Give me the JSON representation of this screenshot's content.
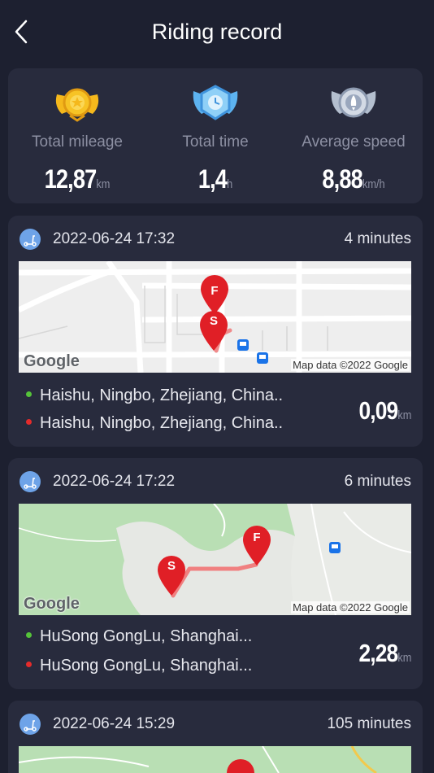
{
  "header": {
    "title": "Riding record",
    "back_icon": "chevron-left-icon"
  },
  "stats": [
    {
      "label": "Total mileage",
      "value": "12,87",
      "unit": "km",
      "badge": "gold-medal-icon"
    },
    {
      "label": "Total time",
      "value": "1,4",
      "unit": "h",
      "badge": "blue-clock-medal-icon"
    },
    {
      "label": "Average speed",
      "value": "8,88",
      "unit": "km/h",
      "badge": "silver-rocket-medal-icon"
    }
  ],
  "rides": [
    {
      "date": "2022-06-24 17:32",
      "duration": "4 minutes",
      "start": "Haishu, Ningbo, Zhejiang, China..",
      "end": "Haishu, Ningbo, Zhejiang, China..",
      "distance": "0,09",
      "unit": "km",
      "map_attribution": "Map data ©2022 Google",
      "map_logo": "Google"
    },
    {
      "date": "2022-06-24 17:22",
      "duration": "6 minutes",
      "start": "HuSong GongLu, Shanghai...",
      "end": "HuSong GongLu, Shanghai...",
      "distance": "2,28",
      "unit": "km",
      "map_attribution": "Map data ©2022 Google",
      "map_logo": "Google"
    },
    {
      "date": "2022-06-24 15:29",
      "duration": "105 minutes"
    }
  ],
  "colors": {
    "background": "#1d2030",
    "card": "#282b3d",
    "accent_blue": "#6ea3e8",
    "start_dot": "#55c33a",
    "end_dot": "#e52b2b",
    "marker": "#e01f26",
    "route": "#f08080"
  }
}
